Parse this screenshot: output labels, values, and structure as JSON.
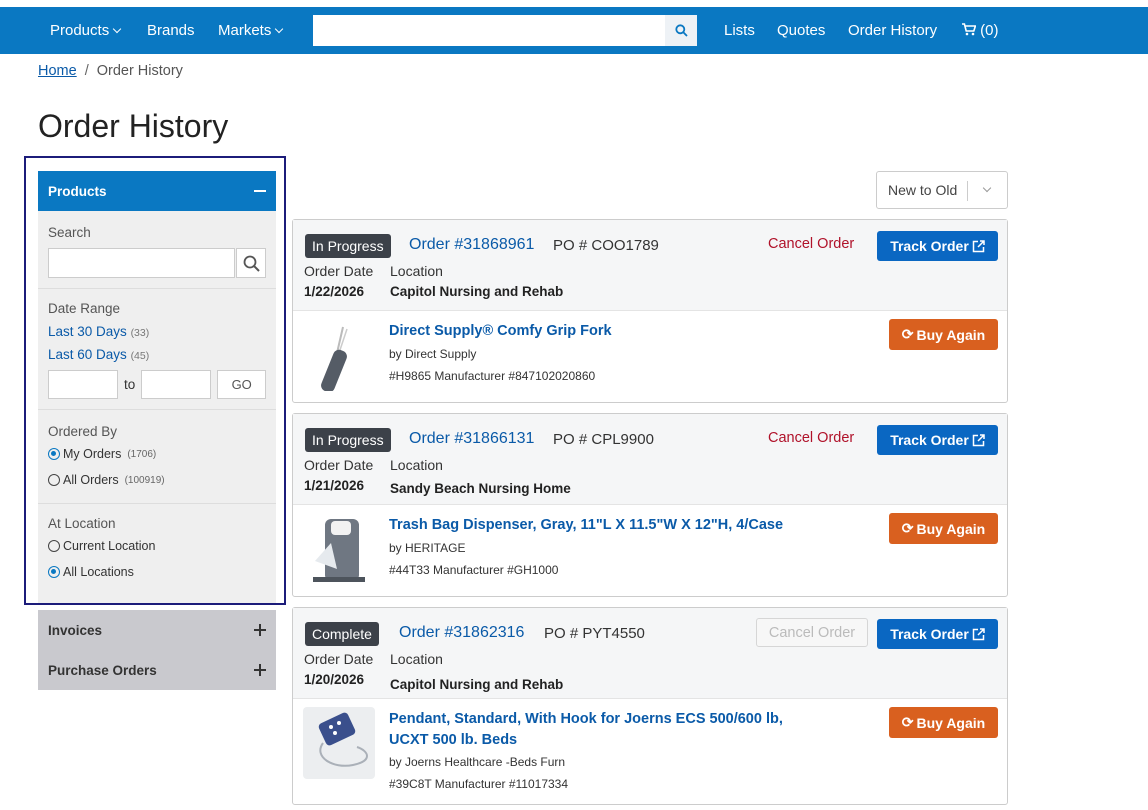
{
  "nav": {
    "products": "Products",
    "brands": "Brands",
    "markets": "Markets",
    "search_placeholder": "",
    "lists": "Lists",
    "quotes": "Quotes",
    "order_history": "Order History",
    "cart_count": "(0)"
  },
  "breadcrumb": {
    "home": "Home",
    "separator": "/",
    "current": "Order History"
  },
  "page_title": "Order History",
  "sidebar": {
    "products_header": "Products",
    "search_label": "Search",
    "date_range_label": "Date Range",
    "last30": "Last 30 Days",
    "last30_count": "(33)",
    "last60": "Last 60 Days",
    "last60_count": "(45)",
    "to_label": "to",
    "go_label": "GO",
    "ordered_by_label": "Ordered By",
    "my_orders": "My Orders",
    "my_orders_count": "(1706)",
    "all_orders": "All Orders",
    "all_orders_count": "(100919)",
    "at_location_label": "At Location",
    "current_location": "Current Location",
    "all_locations": "All Locations",
    "invoices": "Invoices",
    "purchase_orders": "Purchase Orders"
  },
  "sort": {
    "selected": "New to Old"
  },
  "labels": {
    "order_date": "Order Date",
    "location": "Location",
    "cancel_order": "Cancel Order",
    "track_order": "Track Order",
    "buy_again": "Buy Again",
    "po_prefix": "PO #"
  },
  "orders": [
    {
      "status": "In Progress",
      "order_number": "Order #31868961",
      "po": "COO1789",
      "date": "1/22/2026",
      "location": "Capitol Nursing and Rehab",
      "item_title": "Direct Supply® Comfy Grip Fork",
      "item_by": "by Direct Supply",
      "item_sku": "#H9865 Manufacturer #847102020860"
    },
    {
      "status": "In Progress",
      "order_number": "Order #31866131",
      "po": "CPL9900",
      "date": "1/21/2026",
      "location": "Sandy Beach Nursing Home",
      "item_title": "Trash Bag Dispenser, Gray, 11\"L X 11.5\"W X 12\"H, 4/Case",
      "item_by": "by HERITAGE",
      "item_sku": "#44T33 Manufacturer #GH1000"
    },
    {
      "status": "Complete",
      "order_number": "Order #31862316",
      "po": "PYT4550",
      "date": "1/20/2026",
      "location": "Capitol Nursing and Rehab",
      "item_title": "Pendant, Standard, With Hook for Joerns ECS 500/600 lb, UCXT 500 lb. Beds",
      "item_by": "by Joerns Healthcare -Beds Furn",
      "item_sku": "#39C8T Manufacturer #11017334"
    }
  ],
  "colors": {
    "nav": "#0a78c2",
    "link": "#0a5aa8",
    "cancel": "#b0122a",
    "buy": "#d9601f",
    "track": "#0a67c2"
  }
}
